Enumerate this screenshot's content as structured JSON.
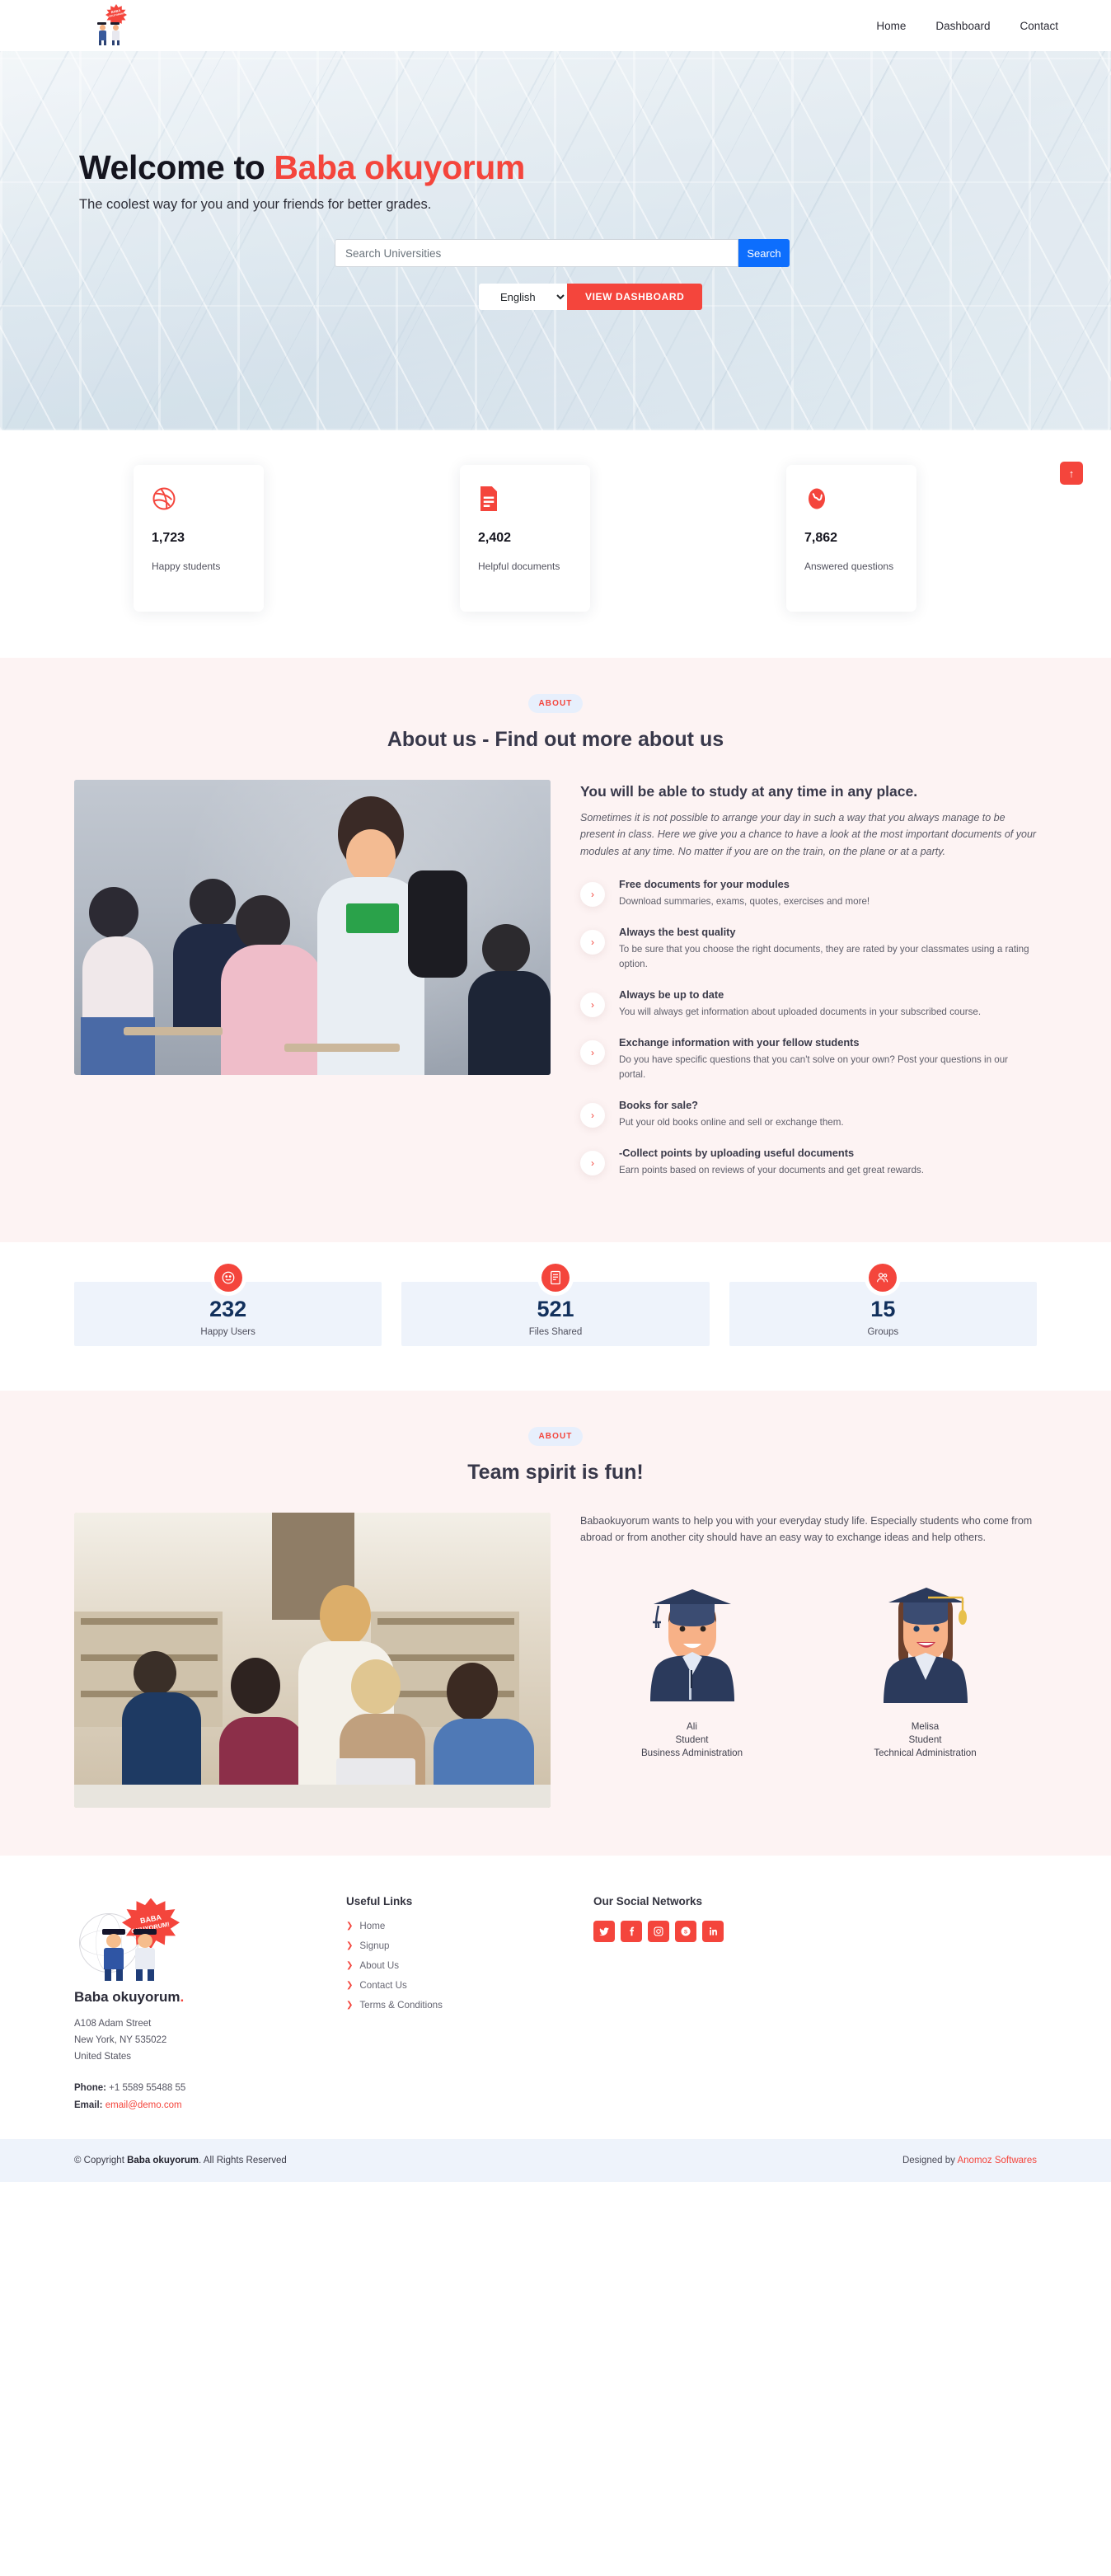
{
  "header": {
    "logo_text_line1": "BABA",
    "logo_text_line2": "OKUYORUM!",
    "nav": [
      {
        "label": "Home"
      },
      {
        "label": "Dashboard"
      },
      {
        "label": "Contact"
      }
    ]
  },
  "hero": {
    "title_prefix": "Welcome to ",
    "title_accent": "Baba okuyorum",
    "tagline": "The coolest way for you and your friends for better grades.",
    "search_placeholder": "Search Universities",
    "search_value": "",
    "search_button": "Search",
    "language_selected": "English",
    "dashboard_button": "VIEW DASHBOARD"
  },
  "stats": [
    {
      "icon": "dribbble-icon",
      "value": "1,723",
      "label": "Happy students"
    },
    {
      "icon": "document-icon",
      "value": "2,402",
      "label": "Helpful documents"
    },
    {
      "icon": "globe-icon",
      "value": "7,862",
      "label": "Answered questions"
    }
  ],
  "scroll_top": {
    "label": "↑"
  },
  "about": {
    "pill": "ABOUT",
    "title": "About us - Find out more about us",
    "heading": "You will be able to study at any time in any place.",
    "lead": "Sometimes it is not possible to arrange your day in such a way that you always manage to be present in class. Here we give you a chance to have a look at the most important documents of your modules at any time. No matter if you are on the train, on the plane or at a party.",
    "features": [
      {
        "title": "Free documents for your modules",
        "text": "Download summaries, exams, quotes, exercises and more!"
      },
      {
        "title": "Always the best quality",
        "text": "To be sure that you choose the right documents, they are rated by your classmates using a rating option."
      },
      {
        "title": "Always be up to date",
        "text": "You will always get information about uploaded documents in your subscribed course."
      },
      {
        "title": "Exchange information with your fellow students",
        "text": "Do you have specific questions that you can't solve on your own? Post your questions in our portal."
      },
      {
        "title": "Books for sale?",
        "text": "Put your old books online and sell or exchange them."
      },
      {
        "title": "-Collect points by uploading useful documents",
        "text": "Earn points based on reviews of your documents and get great rewards."
      }
    ]
  },
  "counters": [
    {
      "icon": "smiley-icon",
      "value": "232",
      "label": "Happy Users"
    },
    {
      "icon": "files-icon",
      "value": "521",
      "label": "Files Shared"
    },
    {
      "icon": "group-icon",
      "value": "15",
      "label": "Groups"
    }
  ],
  "team": {
    "pill": "ABOUT",
    "title": "Team spirit is fun!",
    "intro": "Babaokuyorum wants to help you with your everyday study life. Especially students who come from abroad or from another city should have an easy way to exchange ideas and help others.",
    "members": [
      {
        "name": "Ali",
        "role": "Student",
        "dept": "Business Administration",
        "avatar": "male-graduate-avatar"
      },
      {
        "name": "Melisa",
        "role": "Student",
        "dept": "Technical Administration",
        "avatar": "female-graduate-avatar"
      }
    ]
  },
  "footer": {
    "logo_text_line1": "BABA",
    "logo_text_line2": "OKUYORUM!",
    "brand_name": "Baba okuyorum",
    "brand_dot": ".",
    "address_lines": [
      "A108 Adam Street",
      "New York, NY 535022",
      "United States"
    ],
    "phone_label": "Phone:",
    "phone_value": " +1 5589 55488 55",
    "email_label": "Email:",
    "email_value": "email@demo.com",
    "links_heading": "Useful Links",
    "links": [
      {
        "label": "Home"
      },
      {
        "label": "Signup"
      },
      {
        "label": "About Us"
      },
      {
        "label": "Contact Us"
      },
      {
        "label": "Terms & Conditions"
      }
    ],
    "social_heading": "Our Social Networks",
    "social": [
      {
        "name": "twitter-icon",
        "glyph": "𝕏"
      },
      {
        "name": "facebook-icon",
        "glyph": "f"
      },
      {
        "name": "instagram-icon",
        "glyph": "▢"
      },
      {
        "name": "skype-icon",
        "glyph": "S"
      },
      {
        "name": "linkedin-icon",
        "glyph": "in"
      }
    ],
    "copyright_prefix": "© Copyright ",
    "copyright_brand": "Baba okuyorum",
    "copyright_suffix": ". All Rights Reserved",
    "designed_prefix": "Designed by ",
    "designed_by": "Anomoz Softwares"
  },
  "colors": {
    "accent": "#f4453c",
    "blue": "#0d6efd",
    "navy": "#12305c",
    "soft_pink": "#fdf3f3",
    "soft_blue": "#eef3fb"
  }
}
